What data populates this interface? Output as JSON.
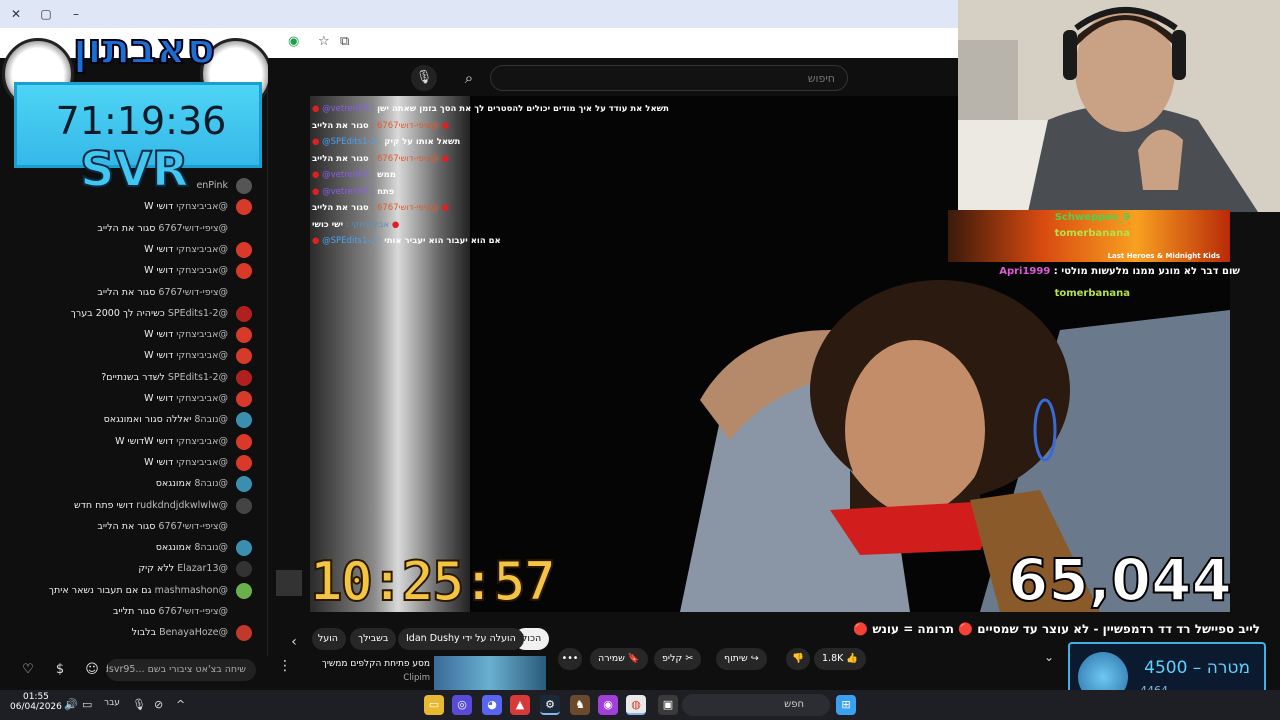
{
  "browser": {
    "close": "✕",
    "tab_label": ""
  },
  "yt": {
    "search_placeholder": "חיפוש",
    "search_icon": "search-icon",
    "mic_icon": "mic-icon"
  },
  "overlay": {
    "logo": "סאבתון",
    "timer": "71:19:36",
    "svr": "SVR"
  },
  "chat": {
    "rows": [
      {
        "name": "enPink",
        "msg": "",
        "color": "#555"
      },
      {
        "name": "@אביביצחקי",
        "msg": "דושי W",
        "color": "#d83a2a"
      },
      {
        "name": "@ציפי-דושי6767",
        "msg": "סגור את הלייב",
        "color": "#0f0f0f"
      },
      {
        "name": "@אביביצחקי",
        "msg": "דושי W",
        "color": "#d83a2a"
      },
      {
        "name": "@אביביצחקי",
        "msg": "דושי W",
        "color": "#d83a2a"
      },
      {
        "name": "@ציפי-דושי6767",
        "msg": "סגור את הלייב",
        "color": "#0f0f0f"
      },
      {
        "name": "@SPEdits1-2",
        "msg": "כשיהיה לך 2000 בערך",
        "color": "#b02020"
      },
      {
        "name": "@אביביצחקי",
        "msg": "דושי W",
        "color": "#d83a2a"
      },
      {
        "name": "@אביביצחקי",
        "msg": "דושי W",
        "color": "#d83a2a"
      },
      {
        "name": "@SPEdits1-2",
        "msg": "לשדר בשנתיים?",
        "color": "#b02020"
      },
      {
        "name": "@אביביצחקי",
        "msg": "דושי W",
        "color": "#d83a2a"
      },
      {
        "name": "@נובה8",
        "msg": "יאללה סגור ואמונגאס",
        "color": "#3a8fb0"
      },
      {
        "name": "@אביביצחקי",
        "msg": "דושי Wדושי W",
        "color": "#d83a2a"
      },
      {
        "name": "@אביביצחקי",
        "msg": "דושי W",
        "color": "#d83a2a"
      },
      {
        "name": "@נובה8",
        "msg": "אמונגאס",
        "color": "#3a8fb0"
      },
      {
        "name": "@rudkdndjdkwlwlw",
        "msg": "דושי פתח חדש",
        "color": "#444"
      },
      {
        "name": "@ציפי-דושי6767",
        "msg": "סגור את הלייב",
        "color": "#0f0f0f"
      },
      {
        "name": "@נובה8",
        "msg": "אמונגאס",
        "color": "#3a8fb0"
      },
      {
        "name": "@Elazar13",
        "msg": "ללא קיק",
        "color": "#333"
      },
      {
        "name": "@mashmashon",
        "msg": "גם אם תעבור נשאר איתך",
        "color": "#6ab04c"
      },
      {
        "name": "@ציפי-דושי6767",
        "msg": "סגור תלייב",
        "color": "#0f0f0f"
      },
      {
        "name": "@BenayaHoze",
        "msg": "בלבול",
        "color": "#c0392b"
      }
    ],
    "input_placeholder": "שיחה בצ'אט ציבורי בשם ...dsvr95"
  },
  "video_chat": [
    {
      "name": "@vetrenFX",
      "msg": "תשאל את עודד על איך מודים יכולים להסטרים לך את הסך בזמן שאתה ישן",
      "ncolor": "#8a5cf0"
    },
    {
      "name": "@ציפי-דושי6767",
      "msg": "סגור את הלייב",
      "ncolor": "#e05a2a"
    },
    {
      "name": "@SPEdits1-2",
      "msg": "תשאל אותו על קיק",
      "ncolor": "#4aa0f0"
    },
    {
      "name": "@ציפי-דושי6767",
      "msg": "סגור את הלייב",
      "ncolor": "#e05a2a"
    },
    {
      "name": "@vetrenFX",
      "msg": "ממש",
      "ncolor": "#8a5cf0"
    },
    {
      "name": "@vetrenFX",
      "msg": "פתח",
      "ncolor": "#8a5cf0"
    },
    {
      "name": "@ציפי-דושי6767",
      "msg": "סגור את הלייב",
      "ncolor": "#e05a2a"
    },
    {
      "name": "אביביצחקי",
      "msg": "ישי כושי",
      "ncolor": "#5a8fc0"
    },
    {
      "name": "@SPEdits1-2",
      "msg": "אם הוא יעבור הוא יעביר אותי",
      "ncolor": "#4aa0f0"
    }
  ],
  "video": {
    "timer": "10:25:57",
    "viewers": "65,044"
  },
  "twitch_chat": [
    {
      "name": "Schweppes_9",
      "msg": "",
      "color": "#4fd14f"
    },
    {
      "name": "tomerbanana",
      "msg": "",
      "color": "#b8e04a"
    },
    {
      "name": "Last Heroes & Midnight Kids",
      "msg": "",
      "color": "#fff"
    },
    {
      "name": "Apri1999",
      "msg": "שום דבר לא מונע ממנו מלעשות מולטי",
      "color": "#e05ad8"
    },
    {
      "name": "tomerbanana",
      "msg": "",
      "color": "#b8e04a"
    }
  ],
  "below": {
    "title": "לייב ספיישל רד דד רדמפשיין - לא עוצר עד שמסיים 🔴 תרומה = עונש 🔴",
    "filters": [
      "הכול",
      "הועלה על ידי Idan Dushy",
      "בשבילך",
      "הועל"
    ],
    "next_title": "מסע פתיחת הקלפים ממשיך",
    "next_channel": "Clipim",
    "likes": "1.8K",
    "share": "שיתוף",
    "clip": "קליפ",
    "save": "שמירה"
  },
  "goal": {
    "label": "מטרה – 4500",
    "current": "4464"
  },
  "taskbar": {
    "time": "01:55",
    "date": "06/04/2026",
    "lang": "עבר",
    "search": "חפש"
  }
}
